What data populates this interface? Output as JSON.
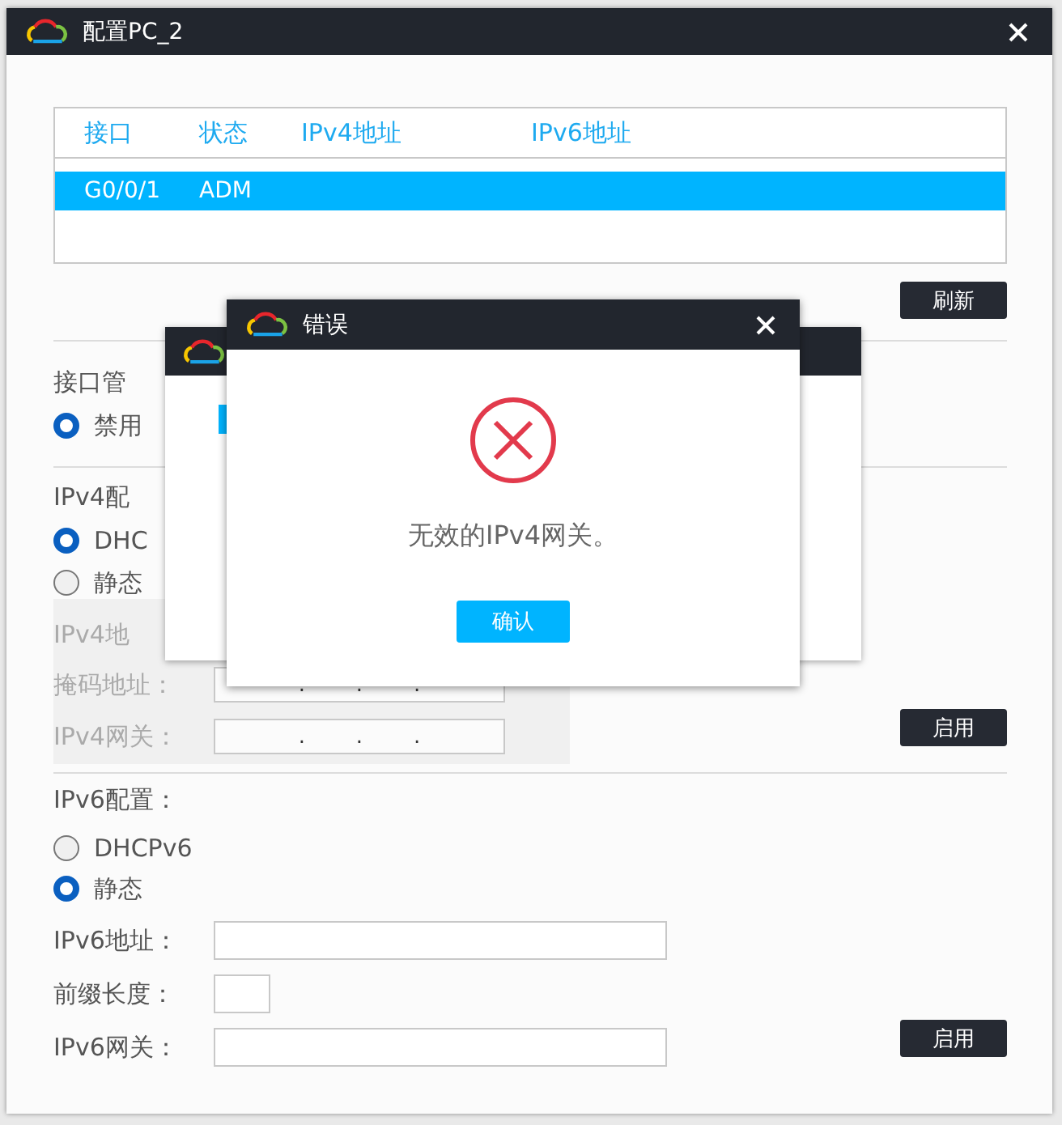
{
  "window": {
    "title": "配置PC_2"
  },
  "interface_table": {
    "columns": [
      "接口",
      "状态",
      "IPv4地址",
      "IPv6地址"
    ],
    "rows": [
      {
        "cells": [
          "G0/0/1",
          "ADM"
        ],
        "selected": true
      }
    ]
  },
  "refresh_button": "刷新",
  "interface_management": {
    "label": "接口管",
    "options": [
      {
        "label": "禁用",
        "selected": true
      }
    ]
  },
  "ipv4_config": {
    "label": "IPv4配",
    "disabled": true,
    "options": [
      {
        "label": "DHC",
        "selected": true
      },
      {
        "label": "静态",
        "selected": false
      }
    ],
    "fields": [
      {
        "label": "IPv4地",
        "kind": "hidden"
      },
      {
        "label": "掩码地址：",
        "kind": "ip",
        "dots": [
          ".",
          ".",
          "."
        ]
      },
      {
        "label": "IPv4网关：",
        "kind": "ip",
        "dots": [
          ".",
          ".",
          "."
        ]
      }
    ],
    "button": "启用"
  },
  "ipv6_config": {
    "label": "IPv6配置：",
    "options": [
      {
        "label": "DHCPv6",
        "selected": false
      },
      {
        "label": "静态",
        "selected": true
      }
    ],
    "fields": [
      {
        "label": "IPv6地址：",
        "kind": "wide"
      },
      {
        "label": "前缀长度：",
        "kind": "short"
      },
      {
        "label": "IPv6网关：",
        "kind": "wide"
      }
    ],
    "button": "启用"
  },
  "error_dialog": {
    "title": "错误",
    "message": "无效的IPv4网关。",
    "button": "确认"
  }
}
